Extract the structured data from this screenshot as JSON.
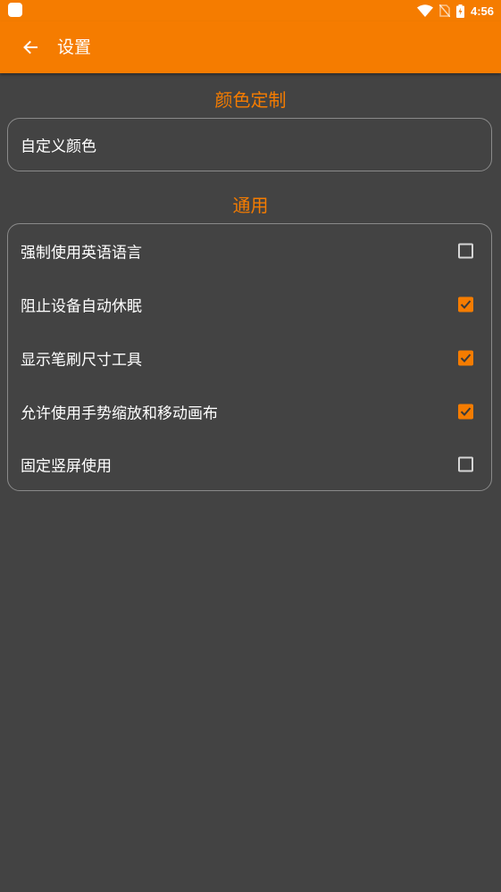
{
  "status_bar": {
    "time": "4:56",
    "icons": [
      "app-notification-icon",
      "wifi-icon",
      "no-sim-icon",
      "battery-charging-icon"
    ]
  },
  "toolbar": {
    "title": "设置",
    "back_icon": "arrow-left-icon"
  },
  "sections": [
    {
      "title": "颜色定制",
      "items": [
        {
          "label": "自定义颜色"
        }
      ]
    },
    {
      "title": "通用",
      "items": [
        {
          "label": "强制使用英语语言",
          "checked": false
        },
        {
          "label": "阻止设备自动休眠",
          "checked": true
        },
        {
          "label": "显示笔刷尺寸工具",
          "checked": true
        },
        {
          "label": "允许使用手势缩放和移动画布",
          "checked": true
        },
        {
          "label": "固定竖屏使用",
          "checked": false
        }
      ]
    }
  ],
  "colors": {
    "accent": "#f57c00",
    "background": "#434343",
    "card_border": "#8a8a8a",
    "text": "#ffffff"
  }
}
